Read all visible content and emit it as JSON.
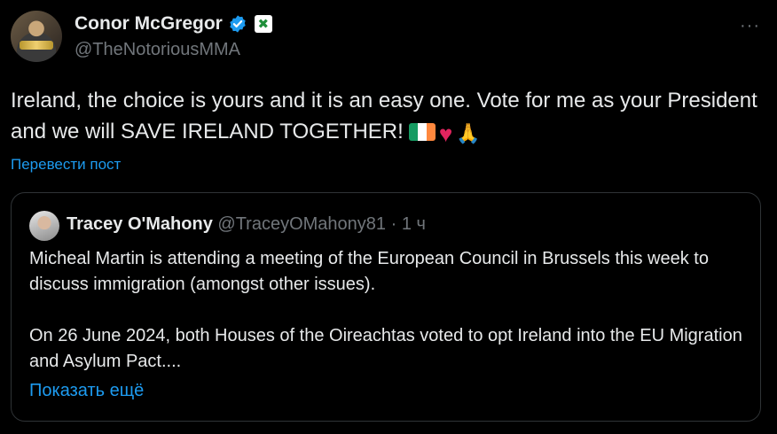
{
  "tweet": {
    "author_name": "Conor McGregor",
    "author_handle": "@TheNotoriousMMA",
    "text": "Ireland, the choice is yours and it is an easy one. Vote for me as your President and we will SAVE IRELAND TOGETHER!",
    "emojis": [
      "irish-flag",
      "red-heart",
      "folded-hands"
    ],
    "translate_label": "Перевести пост",
    "more_label": "···"
  },
  "quote": {
    "author_name": "Tracey O'Mahony",
    "author_handle": "@TraceyOMahony81",
    "time_separator": " · ",
    "time": "1 ч",
    "paragraph1": "Micheal Martin is attending a meeting of the European Council in Brussels this week to discuss immigration (amongst other issues).",
    "paragraph2": "On 26 June 2024, both Houses of the Oireachtas voted to opt Ireland into the EU Migration and Asylum Pact....",
    "show_more_label": "Показать ещё"
  },
  "colors": {
    "background": "#000000",
    "text": "#e7e9ea",
    "secondary": "#71767b",
    "link": "#1d9bf0",
    "border": "#2f3336",
    "verified": "#1d9bf0"
  }
}
